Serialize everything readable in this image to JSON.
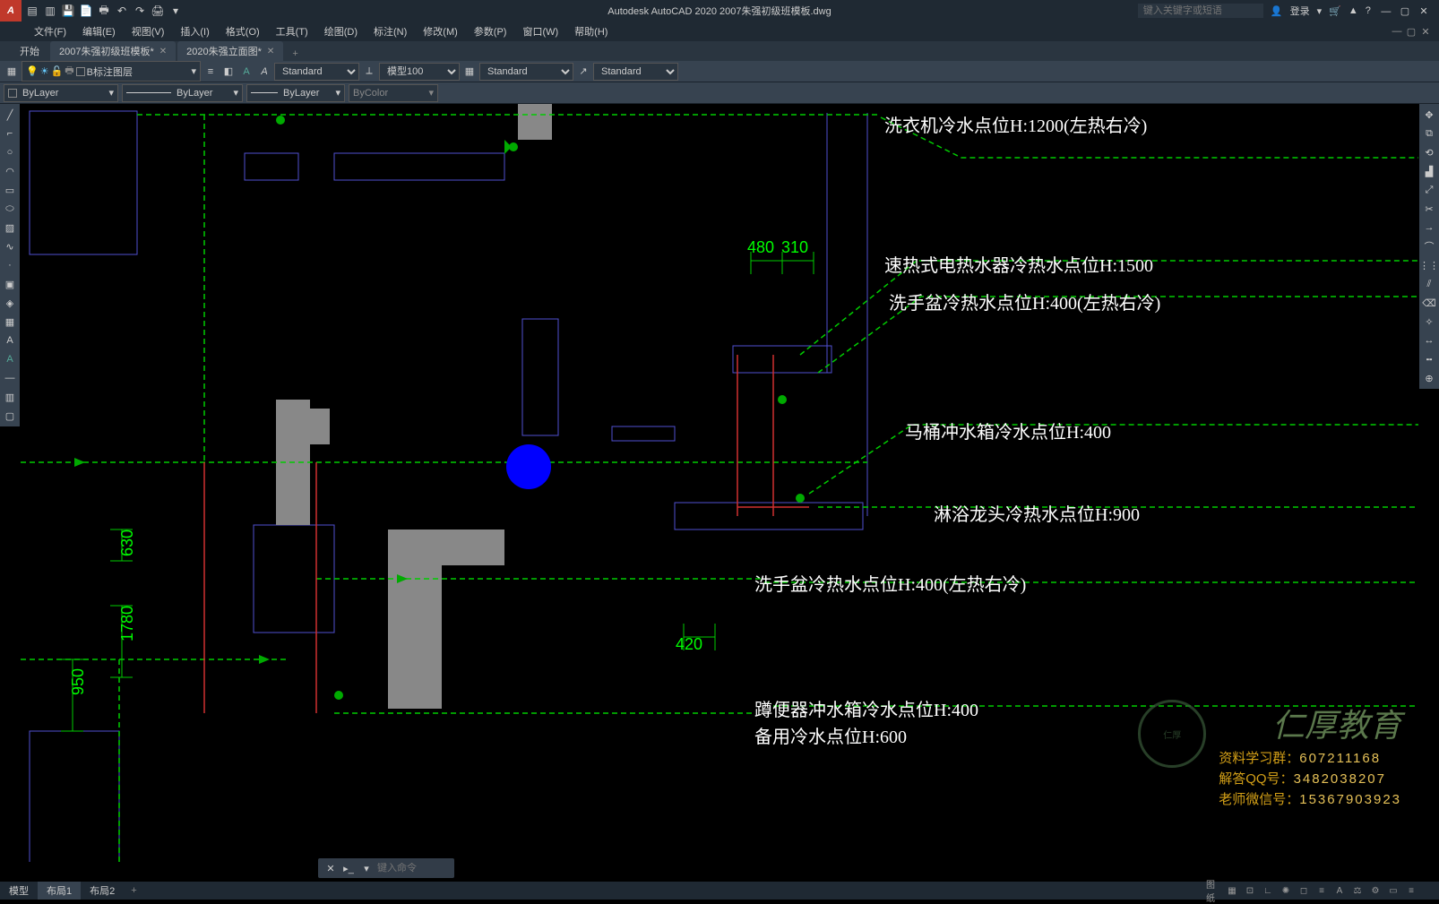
{
  "app": {
    "title": "Autodesk AutoCAD 2020   2007朱强初级班模板.dwg"
  },
  "search": {
    "placeholder": "键入关键字或短语"
  },
  "login": {
    "label": "登录"
  },
  "menu": [
    "文件(F)",
    "编辑(E)",
    "视图(V)",
    "插入(I)",
    "格式(O)",
    "工具(T)",
    "绘图(D)",
    "标注(N)",
    "修改(M)",
    "参数(P)",
    "窗口(W)",
    "帮助(H)"
  ],
  "tabs": [
    {
      "label": "开始"
    },
    {
      "label": "2007朱强初级班模板*",
      "closable": true
    },
    {
      "label": "2020朱强立面图*",
      "closable": true
    }
  ],
  "layer": {
    "current": "B标注图层"
  },
  "styles": {
    "text": "Standard",
    "dim_scale_prefix": "模型100",
    "dim": "Standard",
    "table": "Standard",
    "mleader": "Standard"
  },
  "props": {
    "color": "ByLayer",
    "linetype": "ByLayer",
    "lineweight": "ByLayer",
    "plotstyle": "ByColor"
  },
  "annotations": [
    "洗衣机冷水点位H:1200(左热右冷)",
    "速热式电热水器冷热水点位H:1500",
    "洗手盆冷热水点位H:400(左热右冷)",
    "马桶冲水箱冷水点位H:400",
    "淋浴龙头冷热水点位H:900",
    "洗手盆冷热水点位H:400(左热右冷)",
    "蹲便器冲水箱冷水点位H:400",
    "备用冷水点位H:600"
  ],
  "dims": {
    "d1": "480",
    "d2": "310",
    "d3": "630",
    "d4": "1780",
    "d5": "950",
    "d6": "420"
  },
  "cmd": {
    "placeholder": "键入命令"
  },
  "layouts": [
    "模型",
    "布局1",
    "布局2"
  ],
  "watermark": {
    "brand": "仁厚教育",
    "lines": [
      {
        "label": "资料学习群：",
        "value": "607211168"
      },
      {
        "label": "解答QQ号：",
        "value": "3482038207"
      },
      {
        "label": "老师微信号：",
        "value": "15367903923"
      }
    ]
  }
}
